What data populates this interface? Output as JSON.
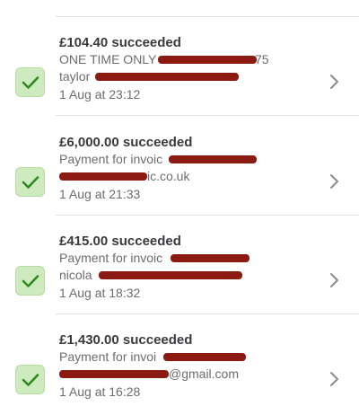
{
  "payments": [
    {
      "amount_status": "£104.40 succeeded",
      "description_visible": "ONE TIME ONLY",
      "description_suffix": "75",
      "customer_visible": "taylor",
      "customer_suffix": "",
      "time": "1 Aug at 23:12"
    },
    {
      "amount_status": "£6,000.00 succeeded",
      "description_visible": "Payment for invoic",
      "description_suffix": "",
      "customer_visible": "",
      "customer_suffix": "ic.co.uk",
      "time": "1 Aug at 21:33"
    },
    {
      "amount_status": "£415.00 succeeded",
      "description_visible": "Payment for invoic",
      "description_suffix": "",
      "customer_visible": "nicola",
      "customer_suffix": "",
      "time": "1 Aug at 18:32"
    },
    {
      "amount_status": "£1,430.00 succeeded",
      "description_visible": "Payment for invoi",
      "description_suffix": "",
      "customer_visible": "",
      "customer_suffix": "@gmail.com",
      "time": "1 Aug at 16:28"
    }
  ],
  "icons": {
    "status": "checkmark-icon",
    "disclosure": "chevron-right-icon"
  },
  "colors": {
    "success_fill": "#cdebbf",
    "success_check": "#2f8a1e",
    "redaction": "#8b1b12"
  }
}
